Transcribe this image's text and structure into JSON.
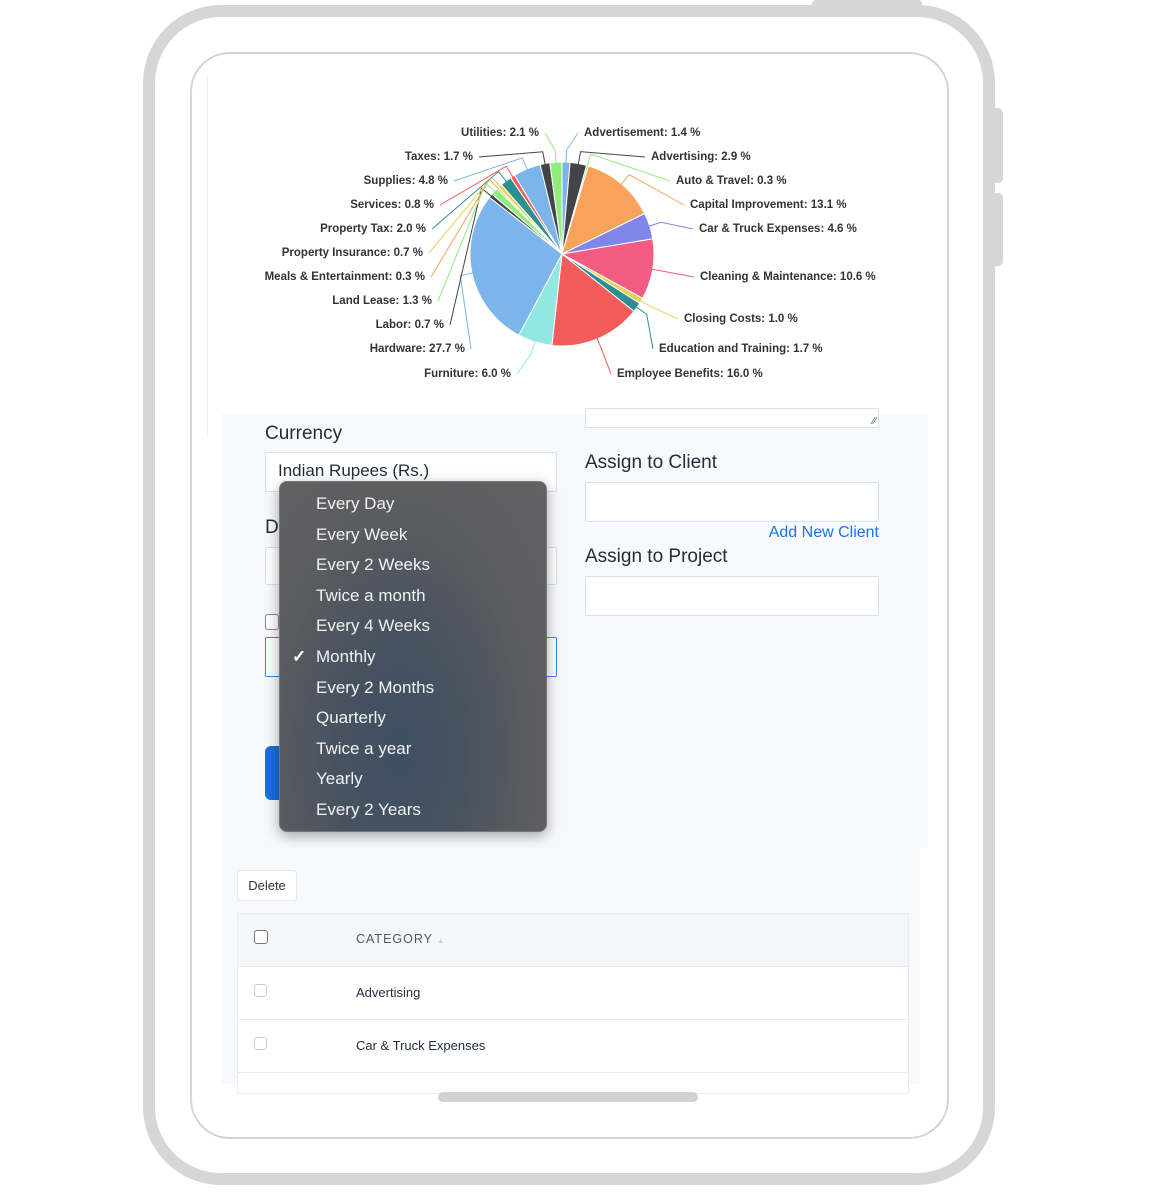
{
  "chart_data": {
    "type": "pie",
    "series": [
      {
        "label": "Advertisement",
        "value": 1.4,
        "color": "#7cb5ec"
      },
      {
        "label": "Advertising",
        "value": 2.9,
        "color": "#434348"
      },
      {
        "label": "Auto & Travel",
        "value": 0.3,
        "color": "#90ed7d"
      },
      {
        "label": "Capital Improvement",
        "value": 13.1,
        "color": "#f7a35c"
      },
      {
        "label": "Car & Truck Expenses",
        "value": 4.6,
        "color": "#8085e9"
      },
      {
        "label": "Cleaning & Maintenance",
        "value": 10.6,
        "color": "#f15c80"
      },
      {
        "label": "Closing Costs",
        "value": 1.0,
        "color": "#e4d354"
      },
      {
        "label": "Education and Training",
        "value": 1.7,
        "color": "#2b908f"
      },
      {
        "label": "Employee Benefits",
        "value": 16.0,
        "color": "#f45b5b"
      },
      {
        "label": "Furniture",
        "value": 6.0,
        "color": "#91e8e1"
      },
      {
        "label": "Hardware",
        "value": 27.7,
        "color": "#7cb5ec"
      },
      {
        "label": "Labor",
        "value": 0.7,
        "color": "#434348"
      },
      {
        "label": "Land Lease",
        "value": 1.3,
        "color": "#90ed7d"
      },
      {
        "label": "Meals & Entertainment",
        "value": 0.3,
        "color": "#f7a35c"
      },
      {
        "label": "Property Insurance",
        "value": 0.7,
        "color": "#e4d354"
      },
      {
        "label": "Property Tax",
        "value": 2.0,
        "color": "#2b908f"
      },
      {
        "label": "Services",
        "value": 0.8,
        "color": "#f45b5b"
      },
      {
        "label": "Supplies",
        "value": 4.8,
        "color": "#7cb5ec"
      },
      {
        "label": "Taxes",
        "value": 1.7,
        "color": "#434348"
      },
      {
        "label": "Utilities",
        "value": 2.1,
        "color": "#90ed7d"
      }
    ],
    "label_texts": [
      "Advertisement: 1.4 %",
      "Advertising: 2.9 %",
      "Auto & Travel: 0.3 %",
      "Capital Improvement: 13.1 %",
      "Car & Truck Expenses: 4.6 %",
      "Cleaning & Maintenance: 10.6 %",
      "Closing Costs: 1.0 %",
      "Education and Training: 1.7 %",
      "Employee Benefits: 16.0 %",
      "Furniture: 6.0 %",
      "Hardware: 27.7 %",
      "Labor: 0.7 %",
      "Land Lease: 1.3 %",
      "Meals & Entertainment: 0.3 %",
      "Property Insurance: 0.7 %",
      "Property Tax: 2.0 %",
      "Services: 0.8 %",
      "Supplies: 4.8 %",
      "Taxes: 1.7 %",
      "Utilities: 2.1 %"
    ]
  },
  "form": {
    "currency_label": "Currency",
    "currency_value": "Indian Rupees (Rs.)",
    "hidden_label_fragment": "D",
    "assign_client_label": "Assign to Client",
    "add_client_link": "Add New Client",
    "assign_project_label": "Assign to Project",
    "link_color": "#1a73e8",
    "primary_color": "#1a6fe0"
  },
  "dropdown": {
    "options": [
      "Every Day",
      "Every Week",
      "Every 2 Weeks",
      "Twice a month",
      "Every 4 Weeks",
      "Monthly",
      "Every 2 Months",
      "Quarterly",
      "Twice a year",
      "Yearly",
      "Every 2 Years"
    ],
    "selected": "Monthly",
    "check_icon": "✓"
  },
  "table": {
    "delete_label": "Delete",
    "header": "CATEGORY",
    "sort_icon": "▲",
    "rows": [
      "Advertising",
      "Car & Truck Expenses"
    ]
  }
}
